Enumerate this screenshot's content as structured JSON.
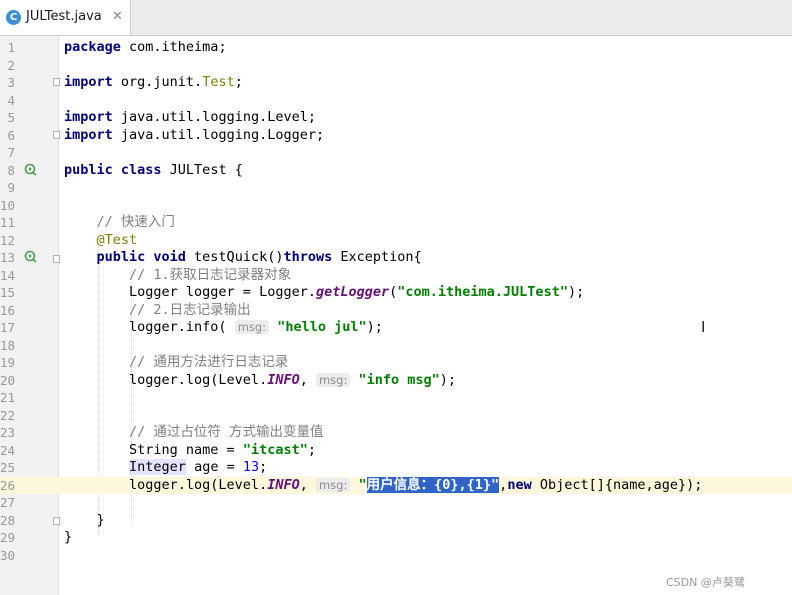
{
  "tab": {
    "icon": "C",
    "label": "JULTest.java",
    "close": "✕"
  },
  "lines": [
    {
      "n": "1",
      "code": [
        {
          "t": "package",
          "c": "kw"
        },
        {
          "t": " com.itheima;"
        }
      ]
    },
    {
      "n": "2",
      "code": []
    },
    {
      "n": "3",
      "code": [
        {
          "t": "import",
          "c": "kw"
        },
        {
          "t": " org.junit."
        },
        {
          "t": "Test",
          "c": "ann"
        },
        {
          "t": ";"
        }
      ]
    },
    {
      "n": "4",
      "code": []
    },
    {
      "n": "5",
      "code": [
        {
          "t": "import",
          "c": "kw"
        },
        {
          "t": " java.util.logging.Level;"
        }
      ]
    },
    {
      "n": "6",
      "code": [
        {
          "t": "import",
          "c": "kw"
        },
        {
          "t": " java.util.logging.Logger;"
        }
      ]
    },
    {
      "n": "7",
      "code": []
    },
    {
      "n": "8",
      "code": [
        {
          "t": "public class",
          "c": "kw"
        },
        {
          "t": " JULTest {"
        }
      ]
    },
    {
      "n": "9",
      "code": []
    },
    {
      "n": "10",
      "code": []
    },
    {
      "n": "11",
      "code": [
        {
          "t": "    "
        },
        {
          "t": "// 快速入门",
          "c": "cm"
        }
      ]
    },
    {
      "n": "12",
      "code": [
        {
          "t": "    "
        },
        {
          "t": "@Test",
          "c": "ann"
        }
      ]
    },
    {
      "n": "13",
      "code": [
        {
          "t": "    "
        },
        {
          "t": "public void",
          "c": "kw"
        },
        {
          "t": " testQuick()"
        },
        {
          "t": "throws",
          "c": "kw"
        },
        {
          "t": " Exception{"
        }
      ]
    },
    {
      "n": "14",
      "code": [
        {
          "t": "        "
        },
        {
          "t": "// 1.获取日志记录器对象",
          "c": "cm"
        }
      ]
    },
    {
      "n": "15",
      "code": [
        {
          "t": "        Logger logger = Logger."
        },
        {
          "t": "getLogger",
          "c": "st"
        },
        {
          "t": "("
        },
        {
          "t": "\"com.itheima.JULTest\"",
          "c": "str"
        },
        {
          "t": ");"
        }
      ]
    },
    {
      "n": "16",
      "code": [
        {
          "t": "        "
        },
        {
          "t": "// 2.日志记录输出",
          "c": "cm"
        }
      ]
    },
    {
      "n": "17",
      "code": [
        {
          "t": "        logger.info( "
        },
        {
          "t": "msg:",
          "c": "hint"
        },
        {
          "t": " "
        },
        {
          "t": "\"hello jul\"",
          "c": "str"
        },
        {
          "t": ");"
        }
      ]
    },
    {
      "n": "18",
      "code": []
    },
    {
      "n": "19",
      "code": [
        {
          "t": "        "
        },
        {
          "t": "// 通用方法进行日志记录",
          "c": "cm"
        }
      ]
    },
    {
      "n": "20",
      "code": [
        {
          "t": "        logger.log(Level."
        },
        {
          "t": "INFO",
          "c": "st"
        },
        {
          "t": ", "
        },
        {
          "t": "msg:",
          "c": "hint"
        },
        {
          "t": " "
        },
        {
          "t": "\"info msg\"",
          "c": "str"
        },
        {
          "t": ");"
        }
      ]
    },
    {
      "n": "21",
      "code": []
    },
    {
      "n": "22",
      "code": []
    },
    {
      "n": "23",
      "code": [
        {
          "t": "        "
        },
        {
          "t": "// 通过占位符 方式输出变量值",
          "c": "cm"
        }
      ]
    },
    {
      "n": "24",
      "code": [
        {
          "t": "        String name = "
        },
        {
          "t": "\"itcast\"",
          "c": "str"
        },
        {
          "t": ";"
        }
      ]
    },
    {
      "n": "25",
      "code": [
        {
          "t": "        "
        },
        {
          "t": "Integer",
          "c": "inw"
        },
        {
          "t": " age = "
        },
        {
          "t": "13",
          "c": "num"
        },
        {
          "t": ";"
        }
      ]
    },
    {
      "n": "26",
      "current": true,
      "code": [
        {
          "t": "        logger.log(Level."
        },
        {
          "t": "INFO",
          "c": "st"
        },
        {
          "t": ", "
        },
        {
          "t": "msg:",
          "c": "hint"
        },
        {
          "t": " "
        },
        {
          "t": "\"",
          "c": "str"
        },
        {
          "t": "用户信息：{0},{1}\"",
          "c": "sel"
        },
        {
          "t": ","
        },
        {
          "t": "new",
          "c": "kw"
        },
        {
          "t": " Object[]{name,age});"
        }
      ]
    },
    {
      "n": "27",
      "code": []
    },
    {
      "n": "28",
      "code": [
        {
          "t": "    }"
        }
      ]
    },
    {
      "n": "29",
      "code": [
        {
          "t": "}"
        }
      ]
    },
    {
      "n": "30",
      "code": []
    }
  ],
  "watermark": "CSDN @卢葵鹭"
}
